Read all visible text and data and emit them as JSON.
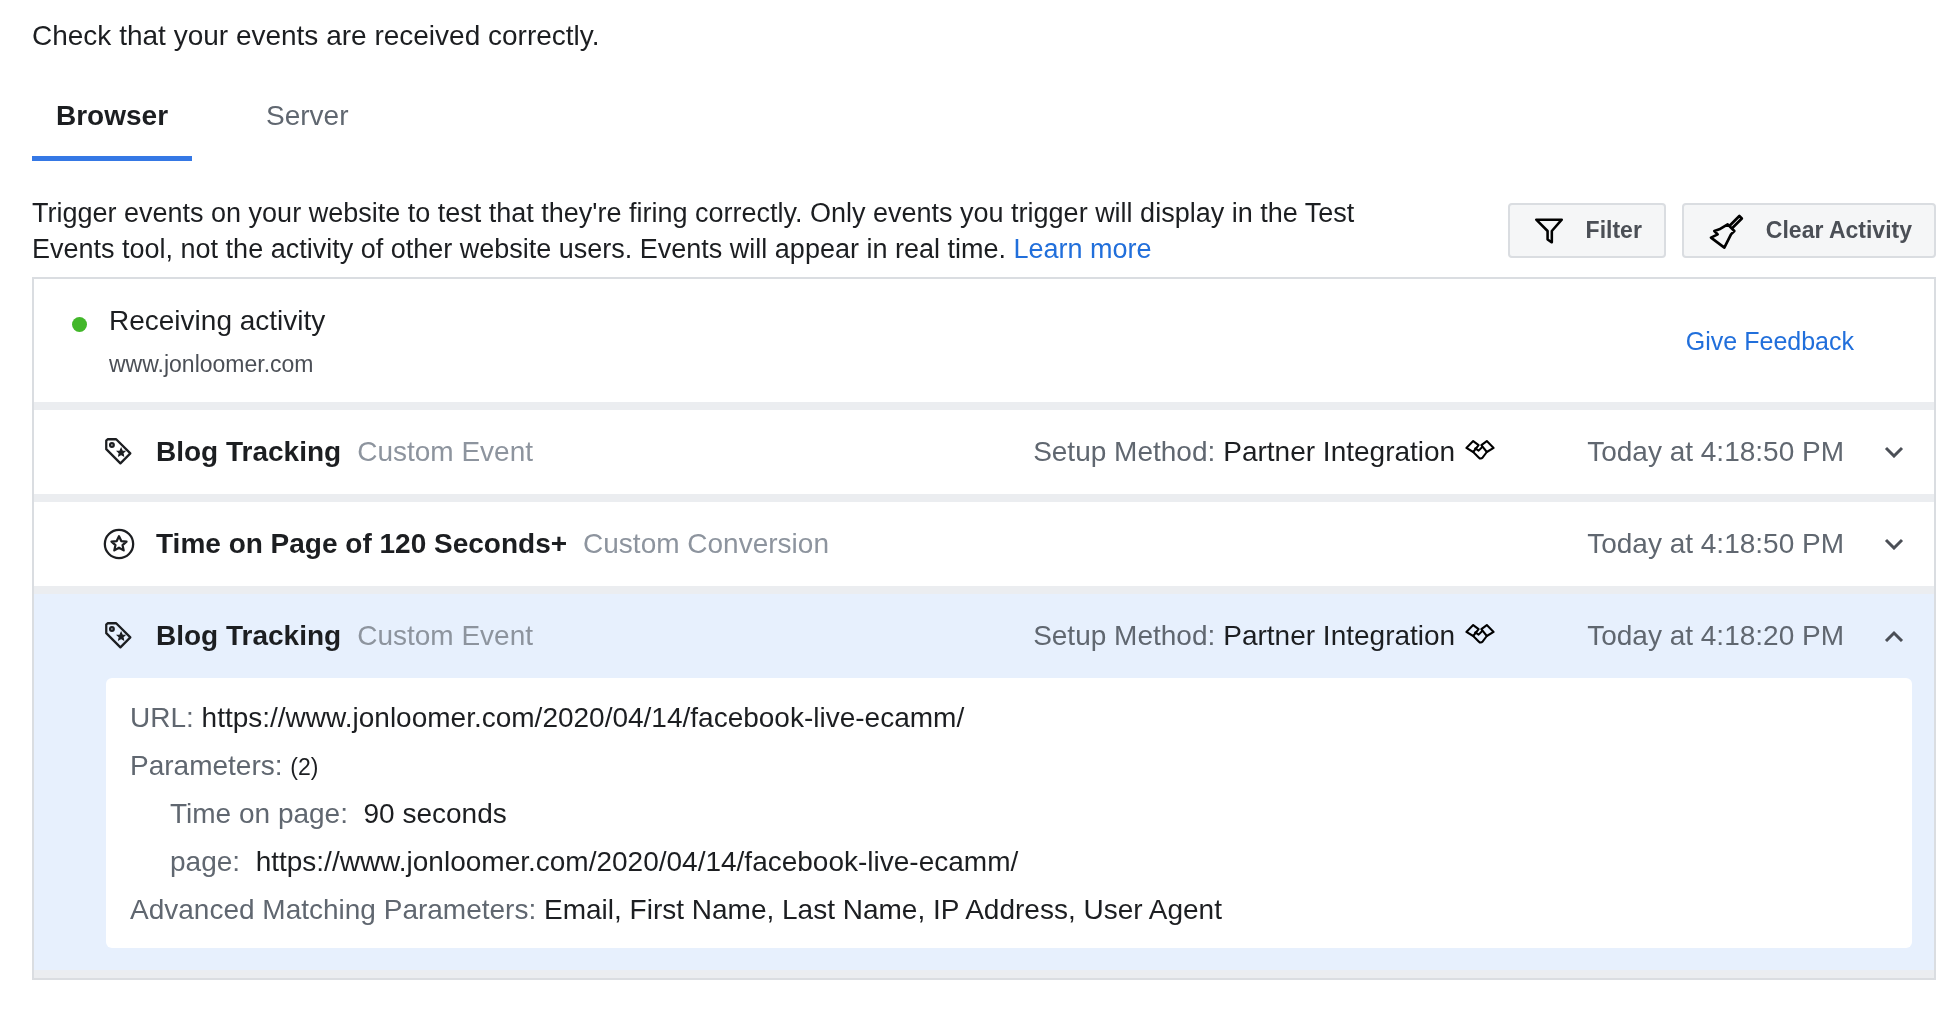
{
  "intro": "Check that your events are received correctly.",
  "tabs": [
    {
      "label": "Browser",
      "selected": true
    },
    {
      "label": "Server",
      "selected": false
    }
  ],
  "description": {
    "text": "Trigger events on your website to test that they're firing correctly. Only events you trigger will display in the Test Events tool, not the activity of other website users. Events will appear in real time.",
    "link": "Learn more"
  },
  "buttons": [
    {
      "kind": "filter",
      "label": "Filter"
    },
    {
      "kind": "clear",
      "label": "Clear Activity"
    }
  ],
  "status": {
    "title": "Receiving activity",
    "site": "www.jonloomer.com",
    "color": "#42b72a",
    "feedback": "Give Feedback"
  },
  "events": [
    {
      "kind": "tag",
      "name": "Blog Tracking",
      "type": "Custom Event",
      "setup_label": "Setup Method:",
      "setup_value": "Partner Integration",
      "time": "Today at 4:18:50 PM",
      "expanded": false
    },
    {
      "kind": "conversion",
      "name": "Time on Page of 120 Seconds+",
      "type": "Custom Conversion",
      "time": "Today at 4:18:50 PM",
      "expanded": false
    },
    {
      "kind": "tag",
      "name": "Blog Tracking",
      "type": "Custom Event",
      "setup_label": "Setup Method:",
      "setup_value": "Partner Integration",
      "time": "Today at 4:18:20 PM",
      "expanded": true,
      "details": {
        "url_label": "URL:",
        "url": "https://www.jonloomer.com/2020/04/14/facebook-live-ecamm/",
        "params_label": "Parameters:",
        "params_count": "(2)",
        "params": [
          {
            "key": "Time on page:",
            "value": "90 seconds"
          },
          {
            "key": "page:",
            "value": "https://www.jonloomer.com/2020/04/14/facebook-live-ecamm/"
          }
        ],
        "advanced_label": "Advanced Matching Parameters:",
        "advanced_value": "Email, First Name, Last Name, IP Address, User Agent"
      }
    }
  ]
}
